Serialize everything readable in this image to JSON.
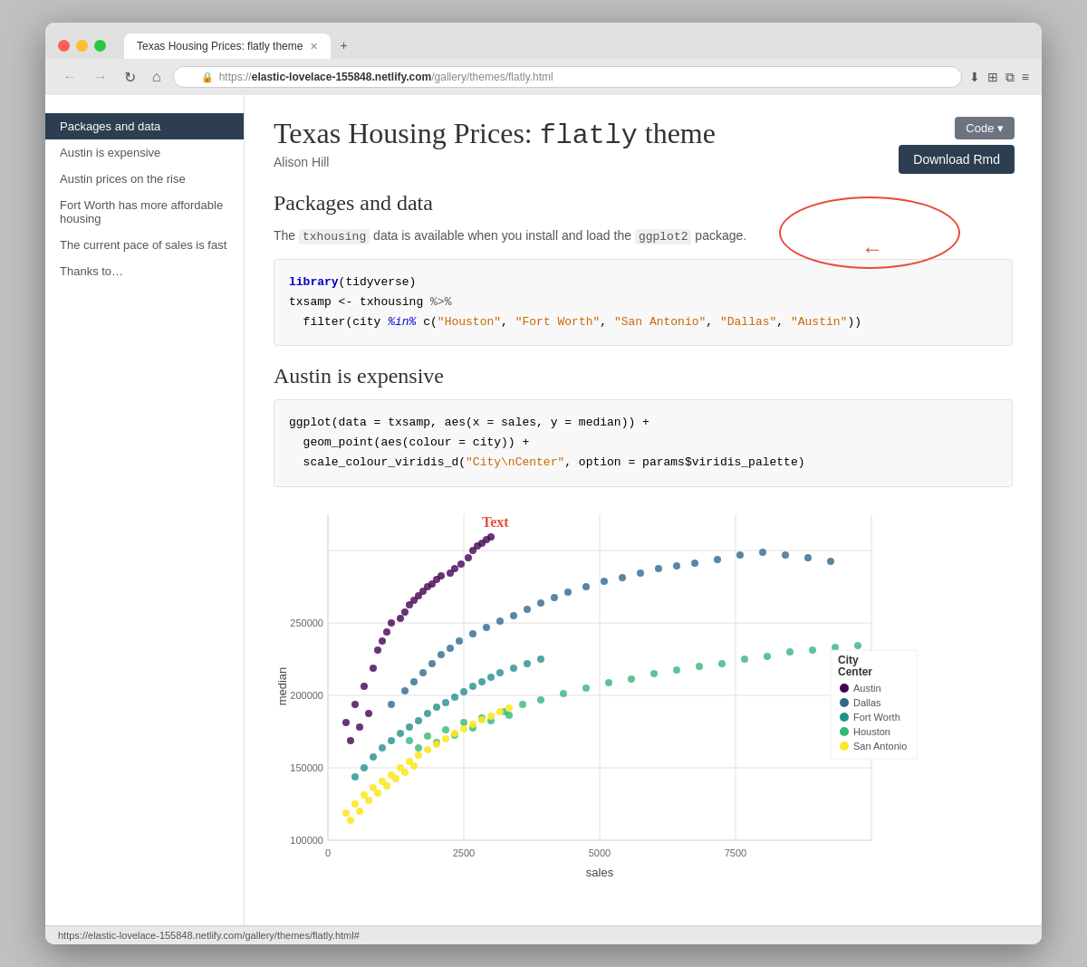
{
  "browser": {
    "tab_title": "Texas Housing Prices: flatly theme",
    "url_prefix": "https://",
    "url_domain": "elastic-lovelace-155848.netlify.com",
    "url_path": "/gallery/themes/flatly.html",
    "status_bar_url": "https://elastic-lovelace-155848.netlify.com/gallery/themes/flatly.html#"
  },
  "sidebar": {
    "items": [
      {
        "id": "packages",
        "label": "Packages and data",
        "active": true
      },
      {
        "id": "expensive",
        "label": "Austin is expensive",
        "active": false
      },
      {
        "id": "prices",
        "label": "Austin prices on the rise",
        "active": false
      },
      {
        "id": "fortworth",
        "label": "Fort Worth has more affordable housing",
        "active": false
      },
      {
        "id": "pace",
        "label": "The current pace of sales is fast",
        "active": false
      },
      {
        "id": "thanks",
        "label": "Thanks to…",
        "active": false
      }
    ]
  },
  "page": {
    "title_prefix": "Texas Housing Prices: ",
    "title_code": "flatly",
    "title_suffix": " theme",
    "author": "Alison Hill",
    "buttons": {
      "code": "Code ▾",
      "download": "Download Rmd"
    },
    "section1": {
      "title": "Packages and data",
      "description_before": "The ",
      "description_code1": "txhousing",
      "description_middle": " data is available when you install and load the ",
      "description_code2": "ggplot2",
      "description_after": " package.",
      "code_lines": [
        "library(tidyverse)",
        "txsamp <- txhousing %>%",
        "  filter(city %in% c(\"Houston\", \"Fort Worth\", \"San Antonio\", \"Dallas\", \"Austin\"))"
      ]
    },
    "section2": {
      "title": "Austin is expensive",
      "code_lines": [
        "ggplot(data = txsamp, aes(x = sales, y = median)) +",
        "  geom_point(aes(colour = city)) +",
        "  scale_colour_viridis_d(\"City\\nCenter\", option = params$viridis_palette)"
      ]
    },
    "chart": {
      "x_label": "sales",
      "y_label": "median",
      "x_ticks": [
        "0",
        "2500",
        "5000",
        "7500"
      ],
      "y_ticks": [
        "100000",
        "150000",
        "200000",
        "250000"
      ],
      "annotation_text": "Text",
      "legend_title": "City\nCenter",
      "legend_items": [
        {
          "city": "Austin",
          "color": "#440154"
        },
        {
          "city": "Dallas",
          "color": "#31688e"
        },
        {
          "city": "Fort Worth",
          "color": "#35b779"
        },
        {
          "city": "Houston",
          "color": "#35b779"
        },
        {
          "city": "San Antonio",
          "color": "#fde725"
        }
      ]
    }
  }
}
